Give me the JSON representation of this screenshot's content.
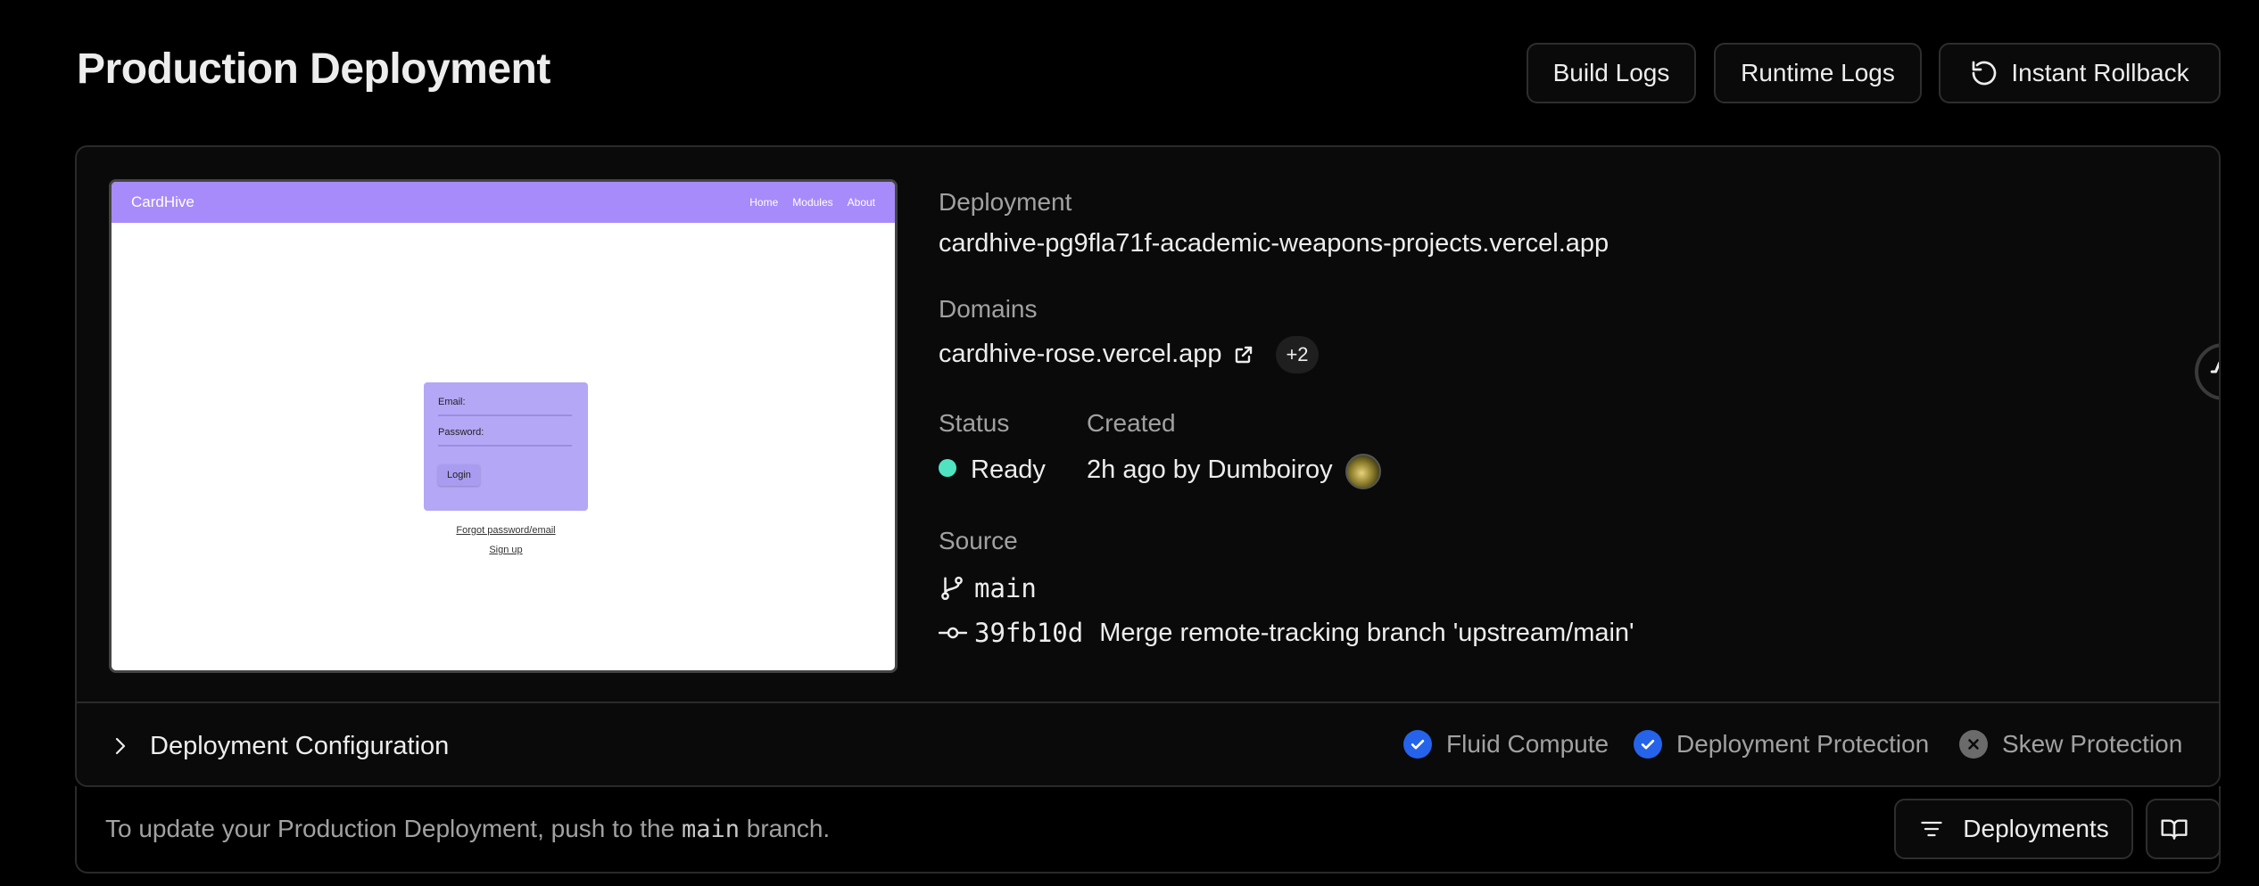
{
  "header": {
    "title": "Production Deployment",
    "build_logs_label": "Build Logs",
    "runtime_logs_label": "Runtime Logs",
    "instant_rollback_label": "Instant Rollback"
  },
  "preview": {
    "brand": "CardHive",
    "nav_links": [
      "Home",
      "Modules",
      "About"
    ],
    "email_label": "Email:",
    "password_label": "Password:",
    "login_label": "Login",
    "forgot_label": "Forgot password/email",
    "signup_label": "Sign up"
  },
  "deployment": {
    "label": "Deployment",
    "url": "cardhive-pg9fla71f-academic-weapons-projects.vercel.app"
  },
  "domains": {
    "label": "Domains",
    "primary": "cardhive-rose.vercel.app",
    "extra_count": "+2"
  },
  "status": {
    "label": "Status",
    "value": "Ready",
    "color": "#50e3c2"
  },
  "created": {
    "label": "Created",
    "value": "2h ago by Dumboiroy"
  },
  "source": {
    "label": "Source",
    "branch": "main",
    "commit_hash": "39fb10d",
    "commit_message": "Merge remote-tracking branch 'upstream/main'"
  },
  "config": {
    "title": "Deployment Configuration",
    "features": [
      {
        "name": "Fluid Compute",
        "enabled": true
      },
      {
        "name": "Deployment Protection",
        "enabled": true
      },
      {
        "name": "Skew Protection",
        "enabled": false
      }
    ],
    "enabled_color": "#2563eb"
  },
  "footer": {
    "text_before": "To update your Production Deployment, push to the",
    "branch": "main",
    "text_after": "branch.",
    "deployments_label": "Deployments"
  }
}
